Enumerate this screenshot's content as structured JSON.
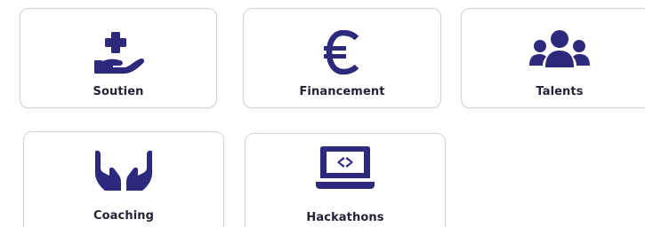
{
  "colors": {
    "icon": "#2d2a7d",
    "label": "#23233a",
    "border": "#d2d2d6",
    "background": "#ffffff"
  },
  "cards": [
    {
      "label": "Soutien",
      "icon": "hand-plus-icon"
    },
    {
      "label": "Financement",
      "icon": "euro-icon"
    },
    {
      "label": "Talents",
      "icon": "users-group-icon"
    },
    {
      "label": "Coaching",
      "icon": "open-hands-icon"
    },
    {
      "label": "Hackathons",
      "icon": "laptop-code-icon"
    }
  ]
}
